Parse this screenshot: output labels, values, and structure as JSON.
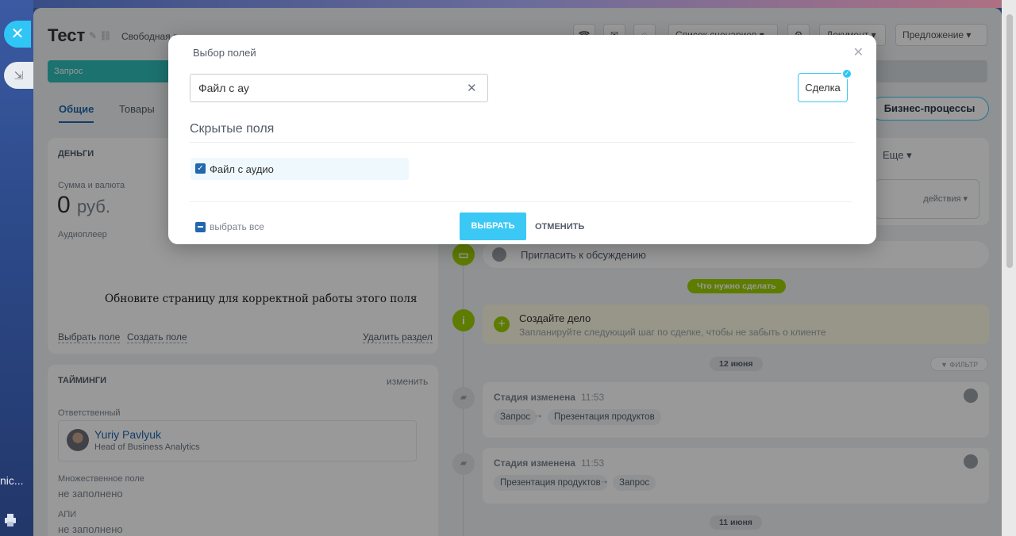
{
  "page": {
    "title": "Тест",
    "subtitle": "Свободная в...",
    "top_buttons": [
      "Список сценариев",
      "Документ",
      "Предложение"
    ],
    "stage_first": "Запрос",
    "tabs": [
      "Общие",
      "Товары"
    ],
    "bp_button": "Бизнес-процессы",
    "more": "Еще",
    "actions": "действия",
    "money": {
      "header": "ДЕНЬГИ",
      "sum_label": "Сумма и валюта",
      "sum_value": "0",
      "currency": "руб.",
      "audio_label": "Аудиоплеер",
      "reload_message": "Обновите страницу для корректной работы этого поля",
      "choose_field": "Выбрать поле",
      "create_field": "Создать поле",
      "delete_section": "Удалить раздел"
    },
    "timings": {
      "header": "ТАЙМИНГИ",
      "edit": "изменить",
      "responsible_label": "Ответственный",
      "person_name": "Yuriy Pavlyuk",
      "person_position": "Head of Business Analytics",
      "multi_label": "Множественное поле",
      "multi_value": "не заполнено",
      "api_label": "АПИ",
      "api_value": "не заполнено"
    },
    "timeline": {
      "invite": "Пригласить к обсуждению",
      "todo_pill": "Что нужно сделать",
      "create_title": "Создайте дело",
      "create_hint": "Запланируйте следующий шаг по сделке, чтобы не забыть о клиенте",
      "date1": "12 июня",
      "filter": "ФИЛЬТР",
      "event1": {
        "title": "Стадия изменена",
        "time": "11:53",
        "from": "Запрос",
        "to": "Презентация продуктов"
      },
      "event2": {
        "title": "Стадия изменена",
        "time": "11:53",
        "from": "Презентация продуктов",
        "to": "Запрос"
      },
      "date2": "11 июня"
    },
    "rail_text": "nic..."
  },
  "modal": {
    "title": "Выбор полей",
    "search_value": "Файл с ау",
    "entity_button": "Сделка",
    "section_title": "Скрытые поля",
    "field_label": "Файл с аудио",
    "field_checked": true,
    "select_all_label": "выбрать все",
    "select_button": "ВЫБРАТЬ",
    "cancel_button": "ОТМЕНИТЬ"
  },
  "colors": {
    "accent": "#2fc6f6",
    "link": "#2067b0",
    "stage": "#2fbfb9",
    "todo": "#9dcf00"
  }
}
